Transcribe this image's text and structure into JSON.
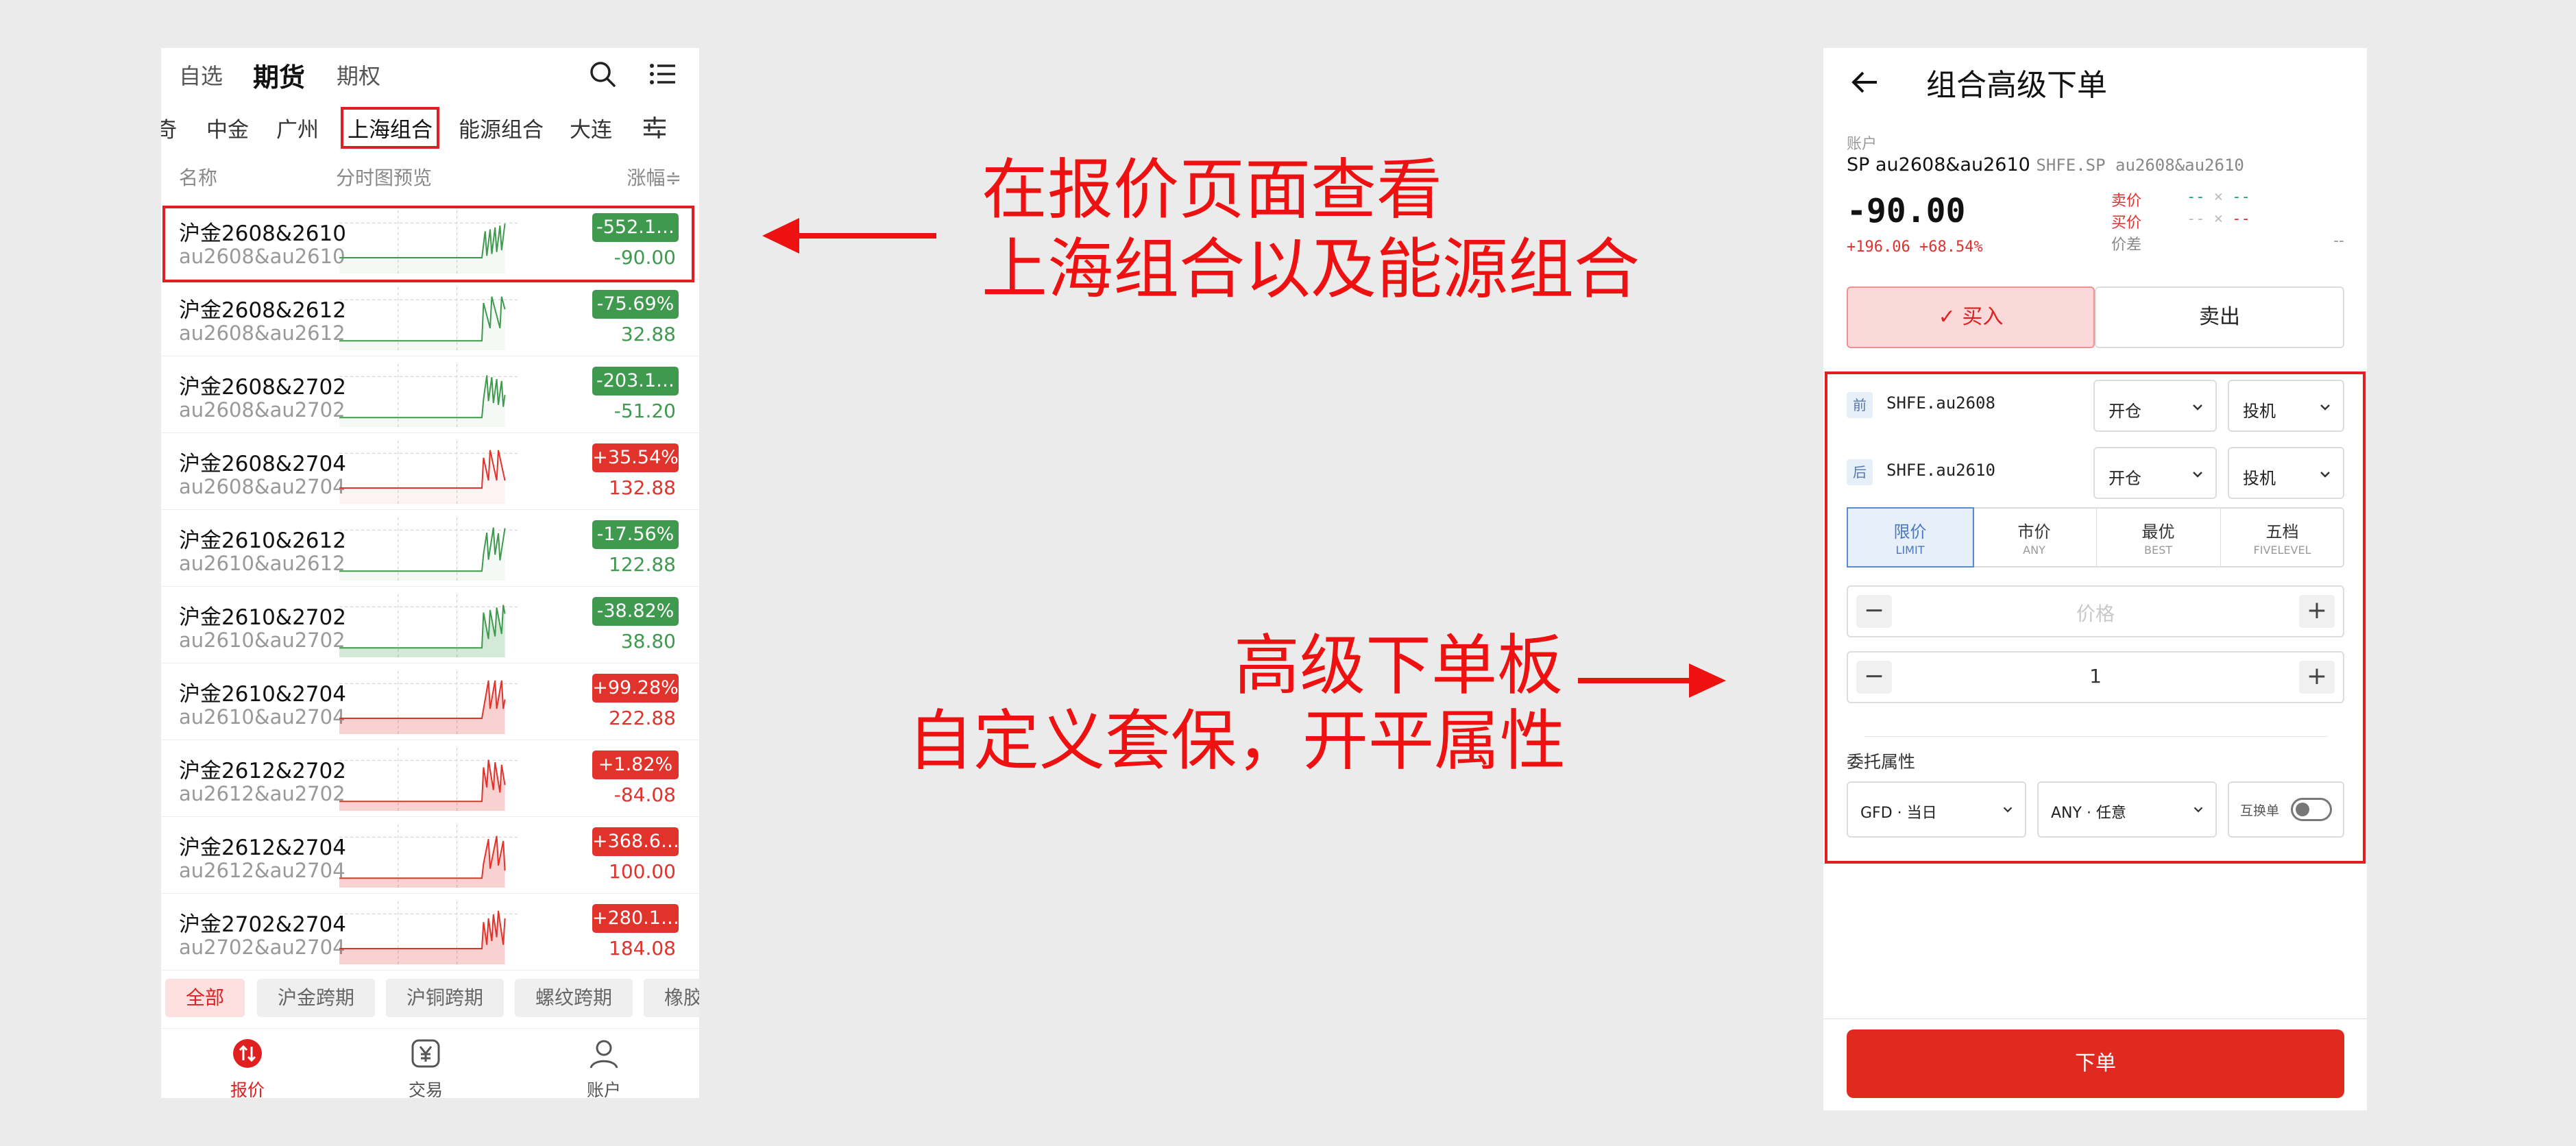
{
  "left": {
    "top_tabs": [
      "自选",
      "期货",
      "期权"
    ],
    "sub_tabs": [
      "奇",
      "中金",
      "广州",
      "上海组合",
      "能源组合",
      "大连"
    ],
    "columns": {
      "name": "名称",
      "chart": "分时图预览",
      "change": "涨幅≑"
    },
    "rows": [
      {
        "name": "沪金2608&2610",
        "code": "au2608&au2610",
        "chg": "-552.1…",
        "last": "-90.00",
        "dir": "down"
      },
      {
        "name": "沪金2608&2612",
        "code": "au2608&au2612",
        "chg": "-75.69%",
        "last": "32.88",
        "dir": "down"
      },
      {
        "name": "沪金2608&2702",
        "code": "au2608&au2702",
        "chg": "-203.1…",
        "last": "-51.20",
        "dir": "down"
      },
      {
        "name": "沪金2608&2704",
        "code": "au2608&au2704",
        "chg": "+35.54%",
        "last": "132.88",
        "dir": "up"
      },
      {
        "name": "沪金2610&2612",
        "code": "au2610&au2612",
        "chg": "-17.56%",
        "last": "122.88",
        "dir": "down"
      },
      {
        "name": "沪金2610&2702",
        "code": "au2610&au2702",
        "chg": "-38.82%",
        "last": "38.80",
        "dir": "down"
      },
      {
        "name": "沪金2610&2704",
        "code": "au2610&au2704",
        "chg": "+99.28%",
        "last": "222.88",
        "dir": "up"
      },
      {
        "name": "沪金2612&2702",
        "code": "au2612&au2702",
        "chg": "+1.82%",
        "last": "-84.08",
        "dir": "up"
      },
      {
        "name": "沪金2612&2704",
        "code": "au2612&au2704",
        "chg": "+368.6…",
        "last": "100.00",
        "dir": "up"
      },
      {
        "name": "沪金2702&2704",
        "code": "au2702&au2704",
        "chg": "+280.1…",
        "last": "184.08",
        "dir": "up"
      }
    ],
    "filters": [
      "全部",
      "沪金跨期",
      "沪铜跨期",
      "螺纹跨期",
      "橡胶"
    ],
    "nav": [
      "报价",
      "交易",
      "账户"
    ]
  },
  "annotations": {
    "top_line1": "在报价页面查看",
    "top_line2": "上海组合以及能源组合",
    "bottom_line1": "高级下单板",
    "bottom_line2": "自定义套保，开平属性"
  },
  "right": {
    "title": "组合高级下单",
    "account_label": "账户",
    "account_name": "SP au2608&au2610",
    "account_code": "SHFE.SP au2608&au2610",
    "price": "-90.00",
    "change": "+196.06 +68.54%",
    "ask_label": "卖价",
    "bid_label": "买价",
    "spread_label": "价差",
    "quote_placeholder": "--",
    "quote_sep": "×",
    "buy": "✓ 买入",
    "sell": "卖出",
    "legs": [
      {
        "badge": "前",
        "symbol": "SHFE.au2608",
        "offset": "开仓",
        "hedge": "投机"
      },
      {
        "badge": "后",
        "symbol": "SHFE.au2610",
        "offset": "开仓",
        "hedge": "投机"
      }
    ],
    "price_types": [
      {
        "label": "限价",
        "sub": "LIMIT"
      },
      {
        "label": "市价",
        "sub": "ANY"
      },
      {
        "label": "最优",
        "sub": "BEST"
      },
      {
        "label": "五档",
        "sub": "FIVELEVEL"
      }
    ],
    "price_placeholder": "价格",
    "quantity": "1",
    "order_attr": "委托属性",
    "tif": "GFD · 当日",
    "volume_cond": "ANY · 任意",
    "swap_label": "互换单",
    "submit": "下单"
  },
  "colors": {
    "up": "#e0332c",
    "down": "#3f9a4f",
    "accent": "#e02020"
  }
}
